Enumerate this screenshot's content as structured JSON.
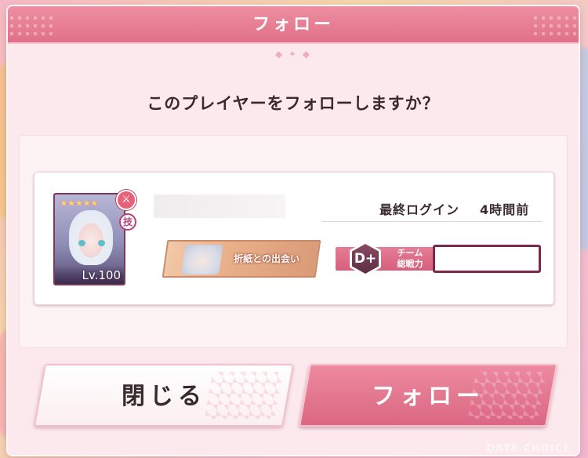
{
  "dialog": {
    "title": "フォロー",
    "question": "このプレイヤーをフォローしますか？"
  },
  "player": {
    "stars": "★★★★★",
    "type_badge_icon": "sword-icon",
    "skill_badge": "技",
    "level": "Lv.100",
    "last_login_label": "最終ログイン",
    "last_login_value": "4時間前",
    "memory_title": "折紙との出会い",
    "rank": "D+",
    "power_label_line1": "チーム",
    "power_label_line2": "総戦力"
  },
  "buttons": {
    "close_label": "閉じる",
    "follow_label": "フォロー"
  },
  "watermark": "DATE CHOICE",
  "colors": {
    "accent": "#e07188",
    "follow_button": "#db6783",
    "rank_band": "#d65f7d",
    "power_border": "#7a2a48"
  }
}
